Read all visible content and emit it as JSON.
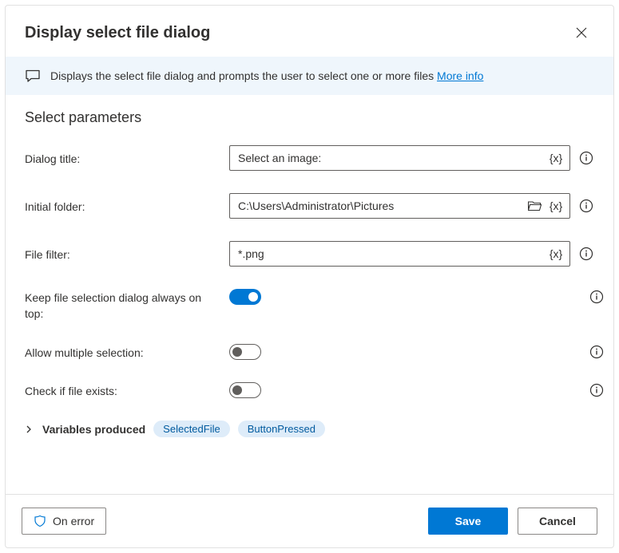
{
  "header": {
    "title": "Display select file dialog"
  },
  "banner": {
    "text": "Displays the select file dialog and prompts the user to select one or more files ",
    "link": "More info"
  },
  "section_title": "Select parameters",
  "fields": {
    "dialog_title": {
      "label": "Dialog title:",
      "value": "Select an image:"
    },
    "initial_folder": {
      "label": "Initial folder:",
      "value": "C:\\Users\\Administrator\\Pictures"
    },
    "file_filter": {
      "label": "File filter:",
      "value": "*.png"
    },
    "always_on_top": {
      "label": "Keep file selection dialog always on top:",
      "value": true
    },
    "allow_multiple": {
      "label": "Allow multiple selection:",
      "value": false
    },
    "check_exists": {
      "label": "Check if file exists:",
      "value": false
    }
  },
  "variables": {
    "label": "Variables produced",
    "items": [
      "SelectedFile",
      "ButtonPressed"
    ]
  },
  "footer": {
    "on_error": "On error",
    "save": "Save",
    "cancel": "Cancel"
  }
}
